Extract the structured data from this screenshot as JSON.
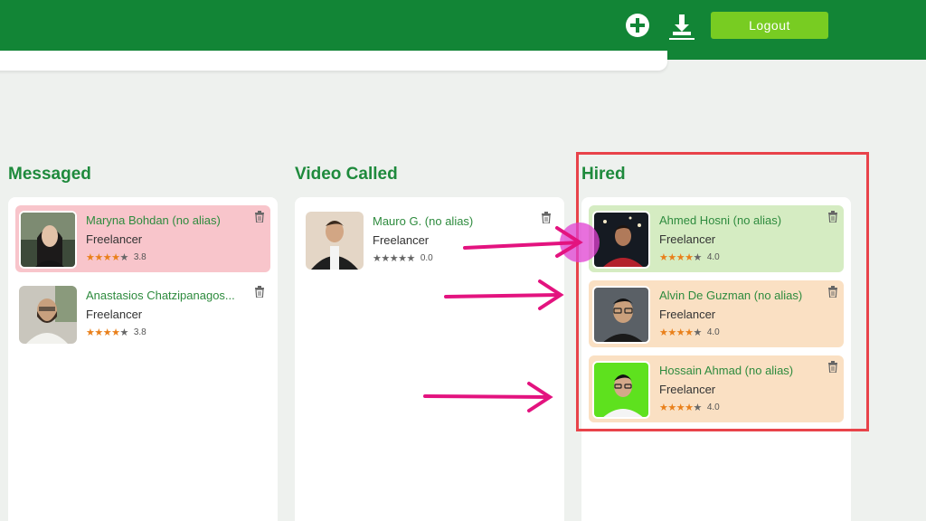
{
  "header": {
    "add_icon": "plus-circle-icon",
    "download_icon": "download-icon",
    "logout_label": "Logout",
    "colors": {
      "header_bg": "#128536",
      "logout_bg": "#78cc22"
    }
  },
  "columns": [
    {
      "title": "Messaged",
      "cards": [
        {
          "name": "Maryna Bohdan (no alias)",
          "role": "Freelancer",
          "rating": "3.8",
          "stars": 4,
          "bg": "#f8c5cb"
        },
        {
          "name": "Anastasios  Chatzipanagos...",
          "role": "Freelancer",
          "rating": "3.8",
          "stars": 4,
          "bg": "#ffffff"
        }
      ]
    },
    {
      "title": "Video Called",
      "cards": [
        {
          "name": "Mauro G.  (no alias)",
          "role": "Freelancer",
          "rating": "0.0",
          "stars": 0,
          "bg": "#ffffff"
        }
      ]
    },
    {
      "title": "Hired",
      "cards": [
        {
          "name": "Ahmed Hosni (no alias)",
          "role": "Freelancer",
          "rating": "4.0",
          "stars": 4,
          "bg": "#d5ecc2"
        },
        {
          "name": "Alvin De Guzman (no alias)",
          "role": "Freelancer",
          "rating": "4.0",
          "stars": 4,
          "bg": "#fae0c3"
        },
        {
          "name": "Hossain Ahmad (no alias)",
          "role": "Freelancer",
          "rating": "4.0",
          "stars": 4,
          "bg": "#fae0c3"
        }
      ]
    }
  ],
  "annotations": {
    "highlight_color": "#e8434a",
    "arrow_color": "#e3137f",
    "cursor_color": "#e040d2"
  }
}
